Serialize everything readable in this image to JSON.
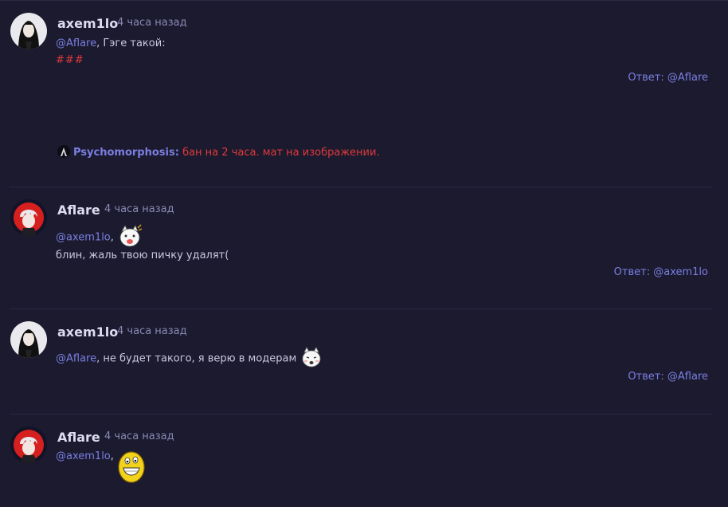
{
  "comments": [
    {
      "username": "axem1lo",
      "time": "4 часа назад",
      "mention": "@Aflare",
      "text": ", Гэге такой:",
      "line2": "###",
      "reply_prefix": "Ответ:",
      "reply_mention": "@Aflare",
      "moderation": {
        "moderator": "Psychomorphosis:",
        "reason": "бан на 2 часа. мат на изображении."
      }
    },
    {
      "username": "Aflare",
      "time": "4 часа назад",
      "mention": "@axem1lo",
      "text": ",",
      "line2": "блин, жаль твою пичку удалят(",
      "reply_prefix": "Ответ:",
      "reply_mention": "@axem1lo"
    },
    {
      "username": "axem1lo",
      "time": "4 часа назад",
      "mention": "@Aflare",
      "text": ", не будет такого, я верю в модерам",
      "reply_prefix": "Ответ:",
      "reply_mention": "@Aflare"
    },
    {
      "username": "Aflare",
      "time": "4 часа назад",
      "mention": "@axem1lo",
      "text": ","
    }
  ],
  "colors": {
    "background": "#1b1a2f",
    "mention": "#7b7fe0",
    "moderation_red": "#e03a3a",
    "timestamp": "#8a89b4"
  },
  "icons": [
    "user-avatar-axem1lo",
    "user-avatar-aflare",
    "moderator-avatar",
    "cat-sticker",
    "smiley-sticker"
  ]
}
